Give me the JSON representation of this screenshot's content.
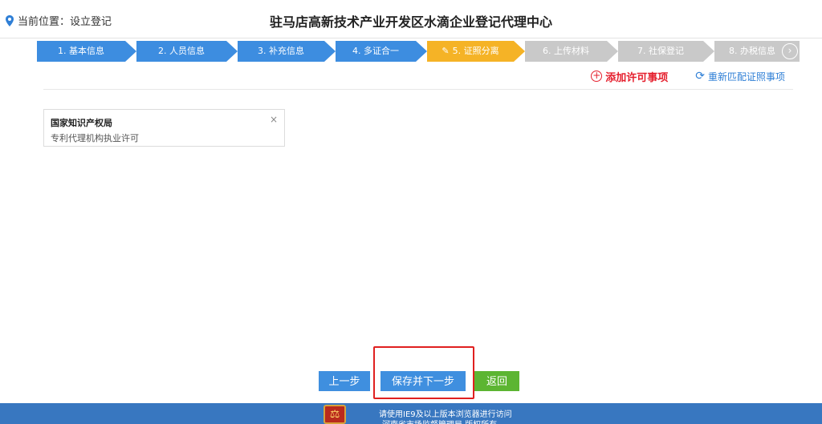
{
  "header": {
    "location_label": "当前位置：设立登记",
    "title": "驻马店高新技术产业开发区水滴企业登记代理中心"
  },
  "steps": [
    {
      "label": "1. 基本信息",
      "state": "done"
    },
    {
      "label": "2. 人员信息",
      "state": "done"
    },
    {
      "label": "3. 补充信息",
      "state": "done"
    },
    {
      "label": "4. 多证合一",
      "state": "done"
    },
    {
      "label": "5. 证照分离",
      "state": "active"
    },
    {
      "label": "6. 上传材料",
      "state": "todo"
    },
    {
      "label": "7. 社保登记",
      "state": "todo"
    },
    {
      "label": "8. 办税信息",
      "state": "todo"
    }
  ],
  "actions": {
    "add_label": "添加许可事项",
    "rematch_label": "重新匹配证照事项"
  },
  "card": {
    "title": "国家知识产权局",
    "subtitle": "专利代理机构执业许可",
    "close_glyph": "×"
  },
  "buttons": {
    "prev": "上一步",
    "save_next": "保存并下一步",
    "back": "返回"
  },
  "footer": {
    "line1": "请使用IE9及以上版本浏览器进行访问",
    "line2": "河南省市场监督管理局 版权所有"
  },
  "colors": {
    "step_done": "#3d8de0",
    "step_active": "#f5b326",
    "step_todo": "#c9c9c9",
    "accent_red": "#e5202e",
    "link_blue": "#2f7fd6",
    "footer_bg": "#3877c0"
  }
}
